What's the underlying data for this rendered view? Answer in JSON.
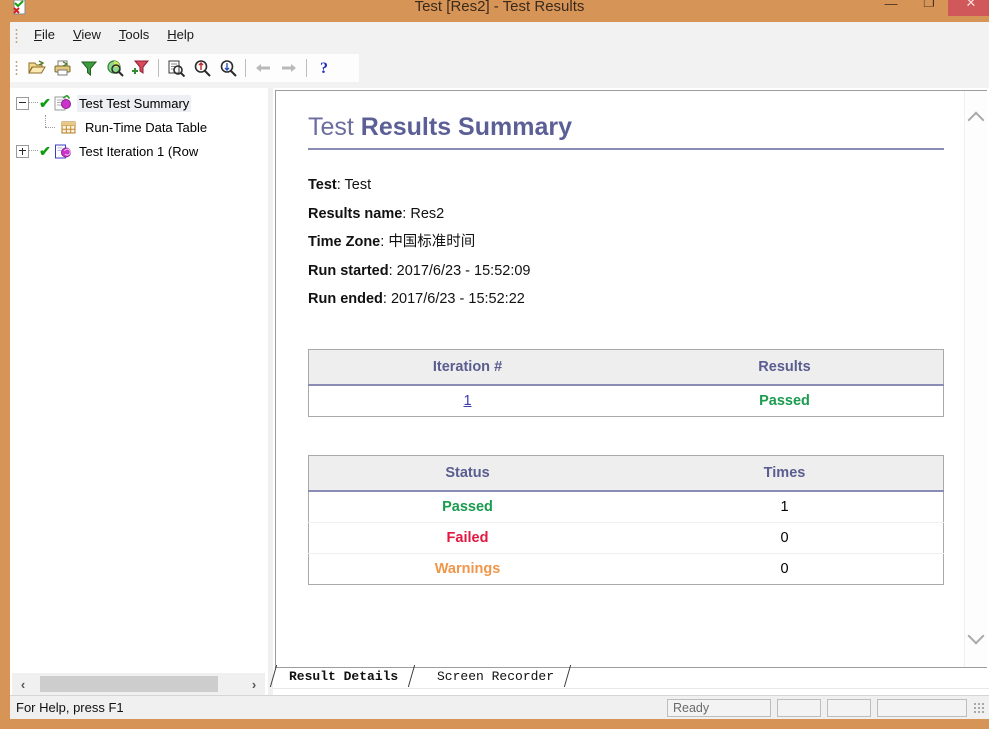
{
  "window": {
    "title": "Test [Res2] - Test Results",
    "app_icon": "test-results-icon",
    "minimize_label": "—",
    "maximize_label": "❐",
    "close_label": "✕"
  },
  "menubar": {
    "items": [
      {
        "name": "file",
        "label": "File",
        "mnemonic": "F",
        "rest": "ile"
      },
      {
        "name": "view",
        "label": "View",
        "mnemonic": "V",
        "rest": "iew"
      },
      {
        "name": "tools",
        "label": "Tools",
        "mnemonic": "T",
        "rest": "ools"
      },
      {
        "name": "help",
        "label": "Help",
        "mnemonic": "H",
        "rest": "elp"
      }
    ]
  },
  "toolbar": {
    "buttons": [
      {
        "name": "open-icon",
        "title": "Open"
      },
      {
        "name": "print-icon",
        "title": "Print"
      },
      {
        "name": "filter-icon",
        "title": "Filter"
      },
      {
        "name": "find-next-icon",
        "title": "Find Next"
      },
      {
        "name": "remove-filter-icon",
        "title": "Remove Filter"
      },
      {
        "name": "page-search-icon",
        "title": "Page Search"
      },
      {
        "name": "zoom-in-icon",
        "title": "Zoom In"
      },
      {
        "name": "zoom-out-icon",
        "title": "Zoom Out"
      },
      {
        "name": "back-arrow-icon",
        "title": "Back"
      },
      {
        "name": "forward-arrow-icon",
        "title": "Forward"
      },
      {
        "name": "help-icon",
        "title": "Help"
      }
    ]
  },
  "tree": {
    "nodes": [
      {
        "label": "Test Test Summary",
        "expander": "minus",
        "checked": true,
        "icon": "test-summary-icon",
        "selected": true,
        "depth": 0
      },
      {
        "label": "Run-Time Data Table",
        "expander": "none",
        "checked": false,
        "icon": "data-table-icon",
        "selected": false,
        "depth": 1
      },
      {
        "label": "Test Iteration 1 (Row",
        "expander": "plus",
        "checked": true,
        "icon": "iteration-icon",
        "selected": false,
        "depth": 0
      }
    ],
    "hscroll": {
      "left_arrow": "‹",
      "right_arrow": "›"
    }
  },
  "report": {
    "title_light": "Test ",
    "title_bold": "Results Summary",
    "meta": [
      {
        "label": "Test",
        "value": "Test"
      },
      {
        "label": "Results name",
        "value": "Res2"
      },
      {
        "label": "Time Zone",
        "value": "中国标准时间"
      },
      {
        "label": "Run started",
        "value": "2017/6/23 - 15:52:09"
      },
      {
        "label": "Run ended",
        "value": "2017/6/23 - 15:52:22"
      }
    ],
    "iteration_table": {
      "headers": [
        "Iteration #",
        "Results"
      ],
      "rows": [
        {
          "iteration": "1",
          "result": "Passed",
          "result_state": "passed"
        }
      ]
    },
    "status_table": {
      "headers": [
        "Status",
        "Times"
      ],
      "rows": [
        {
          "status": "Passed",
          "times": "1",
          "state": "passed"
        },
        {
          "status": "Failed",
          "times": "0",
          "state": "failed"
        },
        {
          "status": "Warnings",
          "times": "0",
          "state": "warning"
        }
      ]
    },
    "scroll": {
      "up": "scroll-up-icon",
      "down": "scroll-down-icon"
    }
  },
  "tabs": [
    {
      "name": "result-details",
      "label": "Result Details",
      "active": true
    },
    {
      "name": "screen-recorder",
      "label": "Screen Recorder",
      "active": false
    }
  ],
  "statusbar": {
    "hint": "For Help, press F1",
    "ready": "Ready",
    "pane2": "",
    "pane3": "",
    "pane4": ""
  },
  "colors": {
    "frame": "#d79457",
    "title_accent": "#6b6d9e",
    "passed": "#1a9b4e",
    "failed": "#e3173f",
    "warning": "#f0964a",
    "link": "#3b3bb5"
  }
}
